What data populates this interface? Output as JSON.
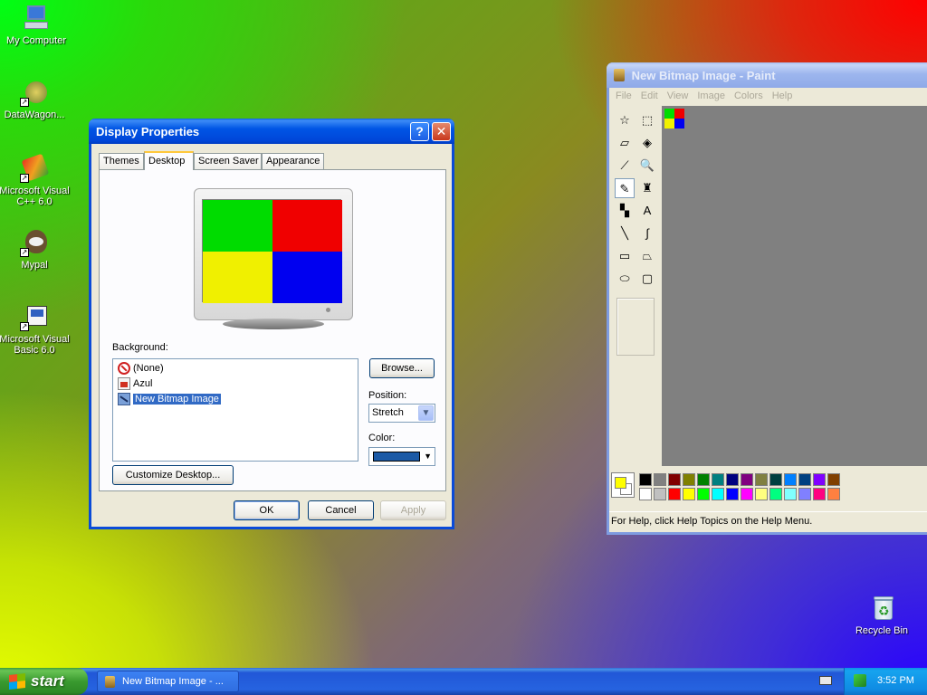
{
  "desktop": {
    "icons": [
      {
        "label": "My Computer"
      },
      {
        "label": "DataWagon..."
      },
      {
        "label": "Microsoft Visual C++ 6.0"
      },
      {
        "label": "Mypal"
      },
      {
        "label": "Microsoft Visual Basic 6.0"
      },
      {
        "label": "Recycle Bin"
      }
    ]
  },
  "display_properties": {
    "title": "Display Properties",
    "help_button": "?",
    "close_button": "✕",
    "tabs": [
      {
        "label": "Themes"
      },
      {
        "label": "Desktop",
        "active": true
      },
      {
        "label": "Screen Saver"
      },
      {
        "label": "Appearance"
      }
    ],
    "monitor_preview_colors": [
      "#00dc00",
      "#f00000",
      "#f0f000",
      "#0000f0"
    ],
    "background_label": "Background:",
    "background_items": [
      {
        "label": "(None)",
        "icon": "no-entry-icon"
      },
      {
        "label": "Azul",
        "icon": "image-file-icon"
      },
      {
        "label": "New Bitmap Image",
        "icon": "bitmap-file-icon",
        "selected": true
      }
    ],
    "browse_label": "Browse...",
    "position_label": "Position:",
    "position_value": "Stretch",
    "color_label": "Color:",
    "color_value": "#1c5aa6",
    "customize_label": "Customize Desktop...",
    "ok_label": "OK",
    "cancel_label": "Cancel",
    "apply_label": "Apply"
  },
  "paint": {
    "title": "New Bitmap Image - Paint",
    "menu": [
      "File",
      "Edit",
      "View",
      "Image",
      "Colors",
      "Help"
    ],
    "tools": [
      {
        "name": "free-select-icon",
        "glyph": "☆"
      },
      {
        "name": "rect-select-icon",
        "glyph": "⬚"
      },
      {
        "name": "eraser-icon",
        "glyph": "▱"
      },
      {
        "name": "fill-icon",
        "glyph": "◈"
      },
      {
        "name": "color-picker-icon",
        "glyph": "⟋"
      },
      {
        "name": "magnifier-icon",
        "glyph": "🔍"
      },
      {
        "name": "pencil-icon",
        "glyph": "✎"
      },
      {
        "name": "brush-icon",
        "glyph": "♜"
      },
      {
        "name": "airbrush-icon",
        "glyph": "▚"
      },
      {
        "name": "text-icon",
        "glyph": "A"
      },
      {
        "name": "line-icon",
        "glyph": "╲"
      },
      {
        "name": "curve-icon",
        "glyph": "∫"
      },
      {
        "name": "rectangle-icon",
        "glyph": "▭"
      },
      {
        "name": "polygon-icon",
        "glyph": "⏢"
      },
      {
        "name": "ellipse-icon",
        "glyph": "⬭"
      },
      {
        "name": "rounded-rect-icon",
        "glyph": "▢"
      }
    ],
    "canvas_colors": [
      "#00dc00",
      "#f00000",
      "#f0f000",
      "#0000f0"
    ],
    "foreground_color": "#ffff00",
    "background_color": "#ffffff",
    "palette_top": [
      "#000000",
      "#808080",
      "#800000",
      "#808000",
      "#008000",
      "#008080",
      "#000080",
      "#800080",
      "#808040",
      "#004040",
      "#0080ff",
      "#004080",
      "#8000ff",
      "#804000"
    ],
    "palette_bottom": [
      "#ffffff",
      "#c0c0c0",
      "#ff0000",
      "#ffff00",
      "#00ff00",
      "#00ffff",
      "#0000ff",
      "#ff00ff",
      "#ffff80",
      "#00ff80",
      "#80ffff",
      "#8080ff",
      "#ff0080",
      "#ff8040"
    ],
    "status": "For Help, click Help Topics on the Help Menu."
  },
  "taskbar": {
    "start_label": "start",
    "task_label": "New Bitmap Image - ...",
    "clock": "3:52 PM"
  }
}
